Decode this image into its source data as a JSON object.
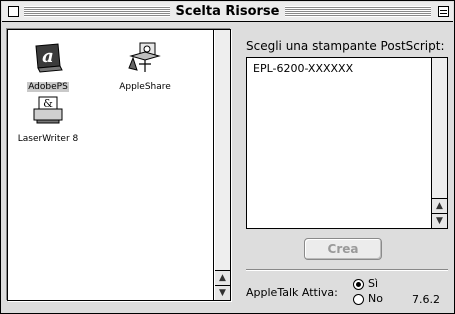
{
  "window": {
    "title": "Scelta Risorse"
  },
  "drivers": [
    {
      "label": "AdobePS",
      "icon": "adobeps-icon",
      "selected": true
    },
    {
      "label": "AppleShare",
      "icon": "appleshare-icon",
      "selected": false
    },
    {
      "label": "LaserWriter 8",
      "icon": "laserwriter-icon",
      "selected": false
    }
  ],
  "printers": {
    "prompt": "Scegli una stampante PostScript:",
    "items": [
      "EPL-6200-XXXXXX"
    ]
  },
  "create_button": {
    "label": "Crea",
    "enabled": false
  },
  "appletalk": {
    "label": "AppleTalk Attiva:",
    "options": [
      {
        "label": "Sì",
        "selected": true
      },
      {
        "label": "No",
        "selected": false
      }
    ]
  },
  "version": "7.6.2",
  "colors": {
    "window_bg": "#dddddd",
    "list_bg": "#ffffff",
    "disabled_text": "#9a9a9a"
  }
}
